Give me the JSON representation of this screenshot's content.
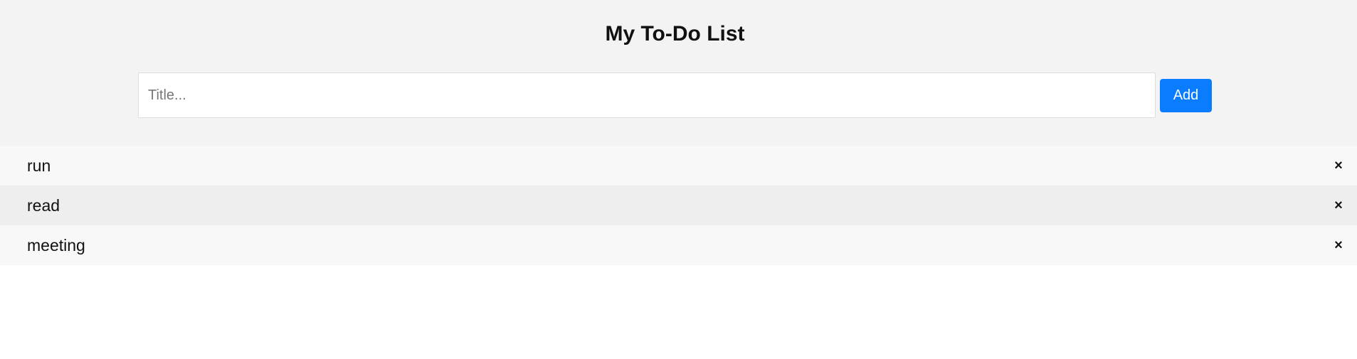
{
  "header": {
    "title": "My To-Do List",
    "input": {
      "value": "",
      "placeholder": "Title..."
    },
    "add_label": "Add"
  },
  "todos": [
    {
      "label": "run",
      "close_glyph": "×"
    },
    {
      "label": "read",
      "close_glyph": "×"
    },
    {
      "label": "meeting",
      "close_glyph": "×"
    }
  ],
  "colors": {
    "header_bg": "#f3f3f3",
    "accent": "#0a7cff",
    "row_odd": "#f8f8f8",
    "row_even": "#eeeeee"
  },
  "icons": {
    "close": "close-icon"
  }
}
